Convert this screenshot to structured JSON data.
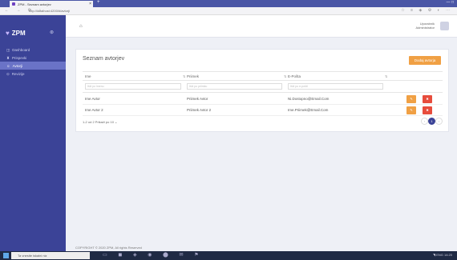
{
  "browser": {
    "tab_title": "ZPM - Seznam avtorjev",
    "tab_close": "×",
    "new_tab": "+",
    "url": "http://localhost:4200/#/avtorji",
    "nav_buttons": "← → ⟳ ⌂",
    "ext_icons": "☆ ≡ ◈ ⚙ ◐ ⋯",
    "win_buttons": "— □"
  },
  "sidebar": {
    "brand": "ZPM",
    "items": [
      {
        "icon": "◫",
        "label": "Dashboard"
      },
      {
        "icon": "♜",
        "label": "Prispevki"
      },
      {
        "icon": "☺",
        "label": "Avtorji"
      },
      {
        "icon": "⊙",
        "label": "Revizije"
      }
    ],
    "active_index": 2
  },
  "topbar": {
    "home_icon": "⌂",
    "user_name": "Uporabnik",
    "user_role": "Administrator"
  },
  "page": {
    "title": "Seznam avtorjev",
    "add_button": "Dodaj avtorja",
    "columns": [
      "Ime",
      "Priimek",
      "E-Pošta"
    ],
    "filter_placeholders": [
      "Išči po imenu",
      "Išči po priimku",
      "Išči po e-pošti"
    ],
    "rows": [
      {
        "ime": "Ime Avtor",
        "priimek": "Priimek Avtor",
        "email": "Ni.Dostopno@Email.Com",
        "edit": "✎",
        "del": "✖"
      },
      {
        "ime": "Ime Avtor 2",
        "priimek": "Priimek Avtor 2",
        "email": "Ime.Priimek@Email.Com",
        "edit": "✎",
        "del": "✖"
      }
    ],
    "pagination": "1-2 od 2   Prikaži po 10 ⌄",
    "page_prev": "‹",
    "page_current": "1",
    "page_next": "›"
  },
  "footer": "COPYRIGHT © 2020 ZPM, All rights Reserved",
  "taskbar": {
    "search_placeholder": "Ta vnesite iskalni niz",
    "icons": "▭ ◼ ◈ ◉ ⬤ ✉ ⚑",
    "tray": "◥ ENG 14:20"
  },
  "colors": {
    "sidebar": "#3b4397",
    "accent": "#f0a044",
    "danger": "#e74c3c",
    "active": "#6a73c7"
  }
}
